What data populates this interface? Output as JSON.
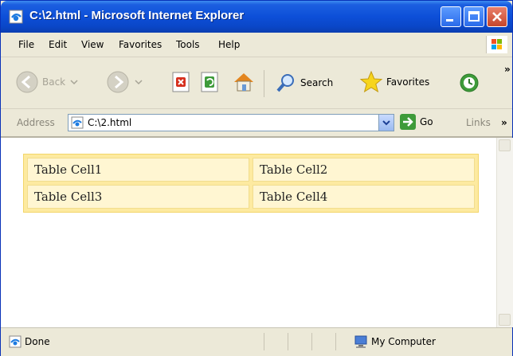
{
  "window": {
    "title": "C:\\2.html - Microsoft Internet Explorer",
    "icon": "ie-page-icon",
    "controls": [
      "minimize-icon",
      "maximize-icon",
      "close-icon"
    ]
  },
  "menu": {
    "items": [
      "File",
      "Edit",
      "View",
      "Favorites",
      "Tools",
      "Help"
    ]
  },
  "toolbar": {
    "back_label": "Back",
    "search_label": "Search",
    "favorites_label": "Favorites",
    "more": "»"
  },
  "address": {
    "label": "Address",
    "value": "C:\\2.html",
    "go_label": "Go",
    "links_label": "Links",
    "links_more": "»"
  },
  "page": {
    "table": [
      [
        "Table Cell1",
        "Table Cell2"
      ],
      [
        "Table Cell3",
        "Table Cell4"
      ]
    ],
    "colors": {
      "table_bg": "#fdeaa0",
      "cell_bg": "#fff6d2"
    }
  },
  "status": {
    "text": "Done",
    "zone": "My Computer"
  }
}
